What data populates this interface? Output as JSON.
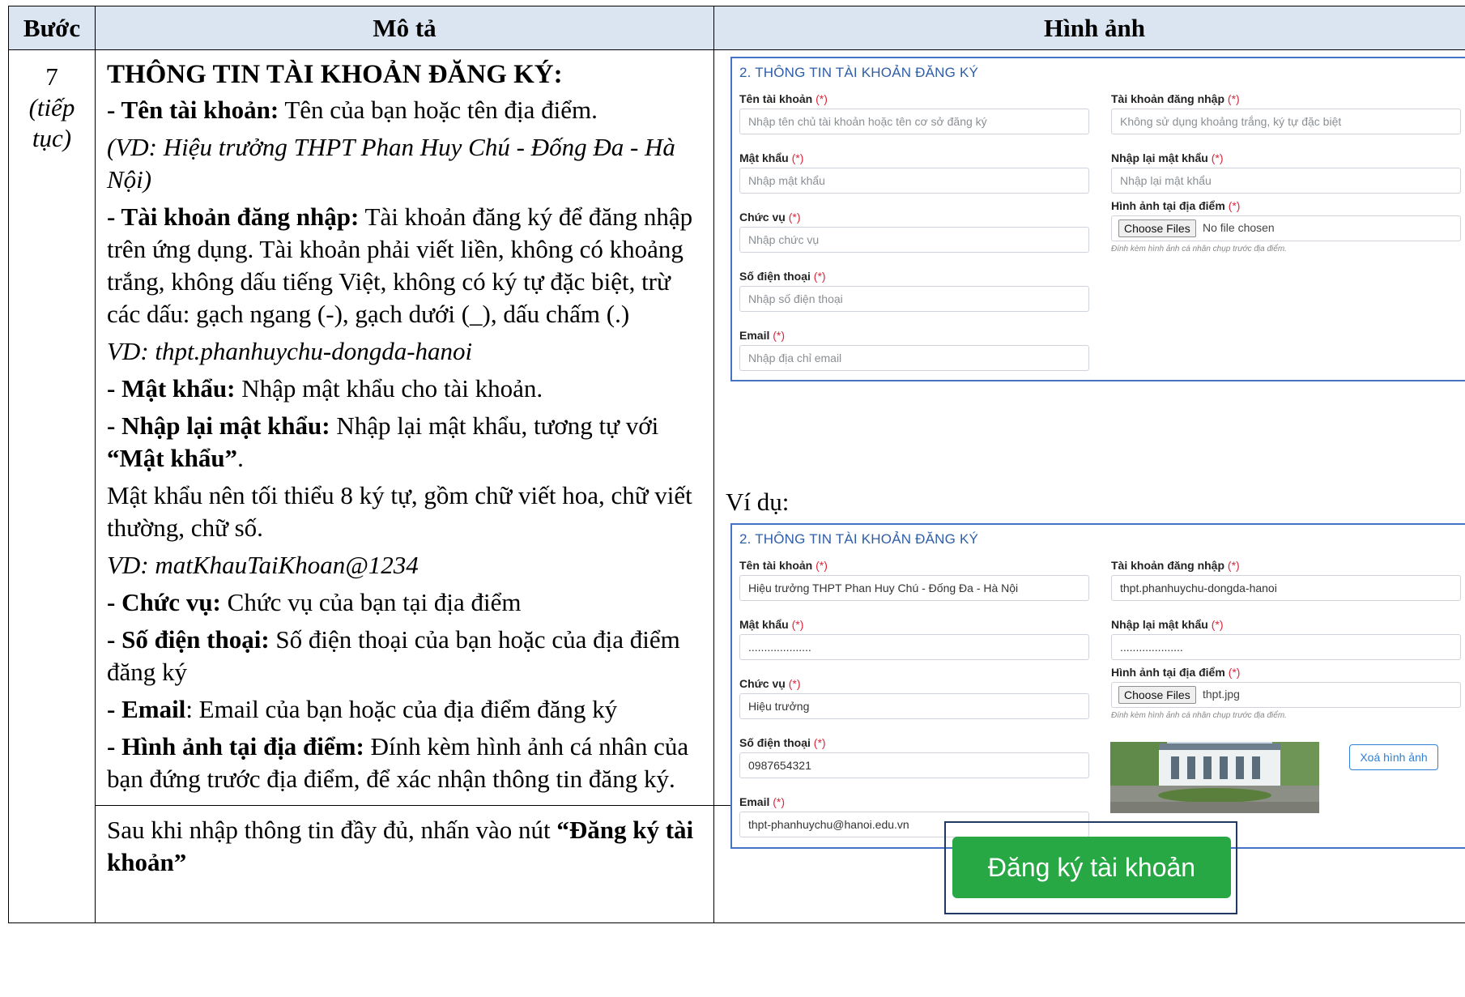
{
  "table": {
    "headers": [
      "Bước",
      "Mô tả",
      "Hình ảnh"
    ],
    "step": {
      "number": "7",
      "note": "(tiếp tục)"
    }
  },
  "desc": {
    "heading": "THÔNG TIN TÀI KHOẢN ĐĂNG KÝ:",
    "items": [
      {
        "label": "- Tên tài khoản:",
        "text": " Tên của bạn hoặc tên địa điểm."
      },
      {
        "example": "(VD: Hiệu trưởng THPT Phan Huy Chú - Đống Đa - Hà Nội)"
      },
      {
        "label": "- Tài khoản đăng nhập:",
        "text": " Tài khoản đăng ký để đăng nhập trên ứng dụng. Tài khoản phải viết liền, không có khoảng trắng, không dấu tiếng Việt, không có ký tự đặc biệt, trừ các dấu: gạch ngang (-), gạch dưới (_), dấu chấm (.)"
      },
      {
        "example": "VD: thpt.phanhuychu-dongda-hanoi"
      },
      {
        "label": "- Mật khẩu:",
        "text": " Nhập mật khẩu cho tài khoản."
      },
      {
        "label": "- Nhập lại mật khẩu:",
        "text": " Nhập lại mật khẩu, tương tự với ",
        "bold_tail": "“Mật khẩu”",
        "tail": "."
      },
      {
        "text": "Mật khẩu nên tối thiểu 8 ký tự, gồm chữ viết hoa, chữ viết thường, chữ số."
      },
      {
        "example": "VD: matKhauTaiKhoan@1234"
      },
      {
        "label": "- Chức vụ:",
        "text": " Chức vụ của bạn tại địa điểm"
      },
      {
        "label": "- Số điện thoại:",
        "text": " Số điện thoại của bạn hoặc của địa điểm đăng ký"
      },
      {
        "label": "- Email",
        "text": ": Email của bạn hoặc của địa điểm đăng ký"
      },
      {
        "label": "- Hình ảnh tại địa điểm:",
        "text": " Đính kèm hình ảnh cá nhân của bạn đứng trước địa điểm, để xác nhận thông tin đăng ký."
      }
    ],
    "final_text": "Sau khi nhập thông tin đầy đủ, nhấn vào nút ",
    "final_bold": "“Đăng ký tài khoản”"
  },
  "form": {
    "title": "2. THÔNG TIN TÀI KHOẢN ĐĂNG KÝ",
    "required_mark": "(*)",
    "labels": {
      "account_name": "Tên tài khoản",
      "login": "Tài khoản đăng nhập",
      "password": "Mật khẩu",
      "password_confirm": "Nhập lại mật khẩu",
      "position": "Chức vụ",
      "image": "Hình ảnh tại địa điểm",
      "phone": "Số điện thoại",
      "email": "Email"
    },
    "placeholders": {
      "account_name": "Nhập tên chủ tài khoản hoặc tên cơ sở đăng ký",
      "login": "Không sử dụng khoảng trắng, ký tự đặc biệt",
      "password": "Nhập mật khẩu",
      "password_confirm": "Nhập lại mật khẩu",
      "position": "Nhập chức vụ",
      "phone": "Nhập số điện thoại",
      "email": "Nhập địa chỉ email"
    },
    "file_button": "Choose Files",
    "file_empty": "No file chosen",
    "file_hint": "Đính kèm hình ảnh cá nhân chụp trước địa điểm."
  },
  "example": {
    "label": "Ví dụ:",
    "values": {
      "account_name": "Hiệu trưởng THPT Phan Huy Chú - Đống Đa -  Hà Nội",
      "login": "thpt.phanhuychu-dongda-hanoi",
      "password": "....................",
      "password_confirm": "....................",
      "position": "Hiệu trưởng",
      "phone": "0987654321",
      "email": "thpt-phanhuychu@hanoi.edu.vn"
    },
    "file_name": "thpt.jpg",
    "delete_image": "Xoá hình ảnh"
  },
  "register_button": "Đăng ký tài khoản",
  "colors": {
    "accent": "#2f5ea8",
    "required": "#d9263b",
    "button": "#28a745",
    "header_bg": "#dbe5f1"
  }
}
